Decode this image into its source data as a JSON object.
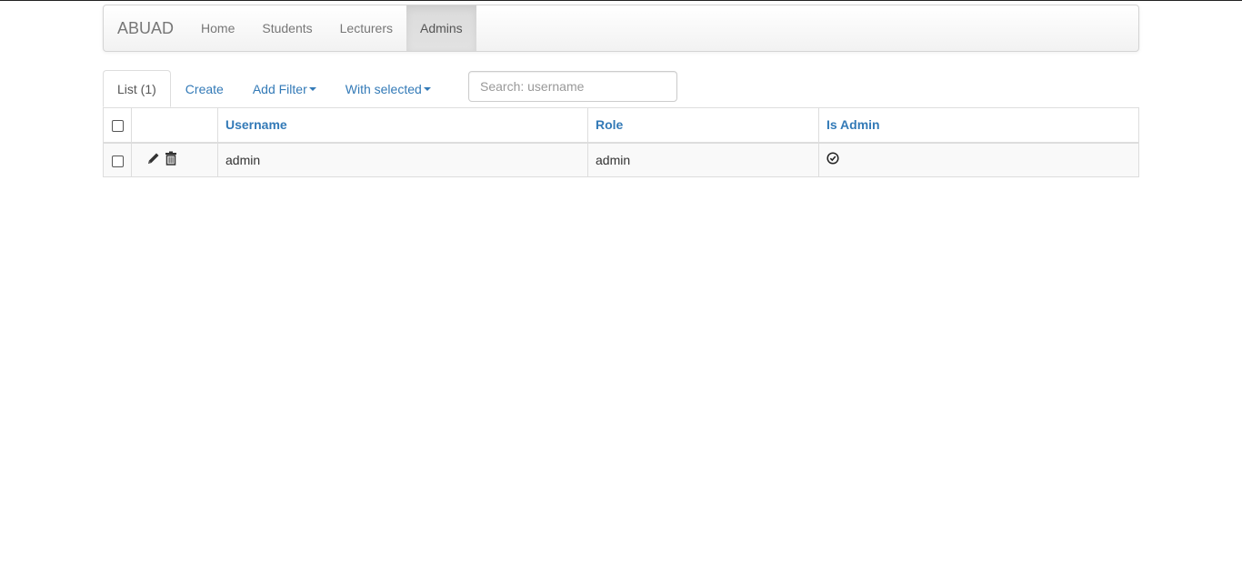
{
  "navbar": {
    "brand": "ABUAD",
    "items": [
      {
        "label": "Home"
      },
      {
        "label": "Students"
      },
      {
        "label": "Lecturers"
      },
      {
        "label": "Admins",
        "active": true
      }
    ]
  },
  "tabs": {
    "list": "List (1)",
    "create": "Create",
    "add_filter": "Add Filter",
    "with_selected": "With selected"
  },
  "search": {
    "placeholder": "Search: username",
    "value": ""
  },
  "table": {
    "headers": {
      "username": "Username",
      "role": "Role",
      "is_admin": "Is Admin"
    },
    "rows": [
      {
        "username": "admin",
        "role": "admin",
        "is_admin_icon": "check-circle-icon"
      }
    ]
  },
  "icons": {
    "edit": "pencil-icon",
    "delete": "trash-icon"
  },
  "colors": {
    "link": "#337ab7",
    "text": "#333333",
    "nav_text": "#777777",
    "border": "#dddddd"
  }
}
